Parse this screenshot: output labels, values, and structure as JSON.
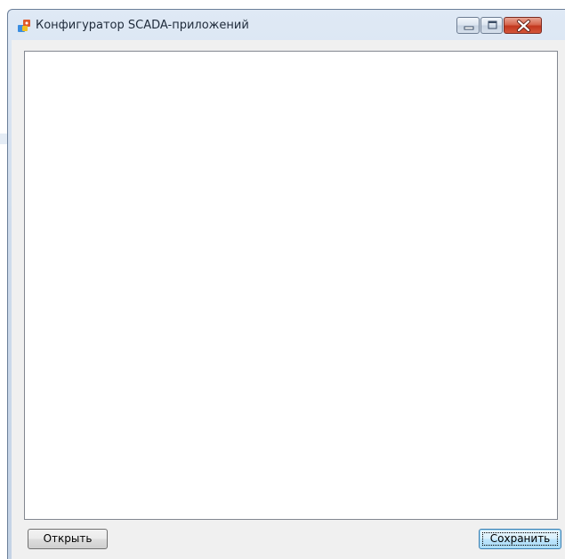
{
  "window": {
    "title": "Конфигуратор SCADA-приложений",
    "app_icon": "scada-app-icon",
    "controls": {
      "minimize_icon": "minimize-icon",
      "maximize_icon": "maximize-icon",
      "close_icon": "close-icon"
    }
  },
  "editor": {
    "content": ""
  },
  "footer": {
    "open_label": "Открыть",
    "save_label": "Сохранить"
  },
  "colors": {
    "close_button": "#c2381f",
    "save_button_border": "#3c7fb1",
    "titlebar": "#cfdcec"
  }
}
